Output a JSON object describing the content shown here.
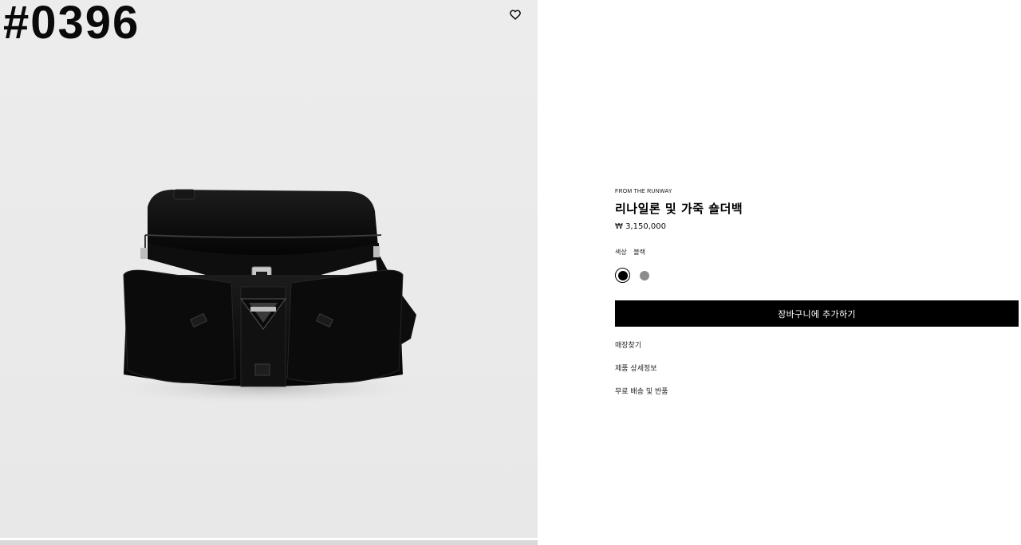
{
  "watermark": "#0396",
  "gallery": {
    "wishlist_icon": "heart-icon"
  },
  "product": {
    "eyebrow": "FROM THE RUNWAY",
    "title": "리나일론 및 가죽 숄더백",
    "price": "₩ 3,150,000",
    "color_label": "색상",
    "color_value": "블랙",
    "swatches": [
      {
        "name": "black",
        "color": "#000000",
        "selected": true
      },
      {
        "name": "grey",
        "color": "#8c8c8c",
        "selected": false
      }
    ],
    "add_to_cart_label": "장바구니에 추가하기",
    "links": [
      "매장찾기",
      "제품 상세정보",
      "무료 배송 및 반품"
    ]
  },
  "colors": {
    "button_bg": "#000000",
    "button_text": "#ffffff",
    "gallery_bg": "#ebebeb"
  }
}
